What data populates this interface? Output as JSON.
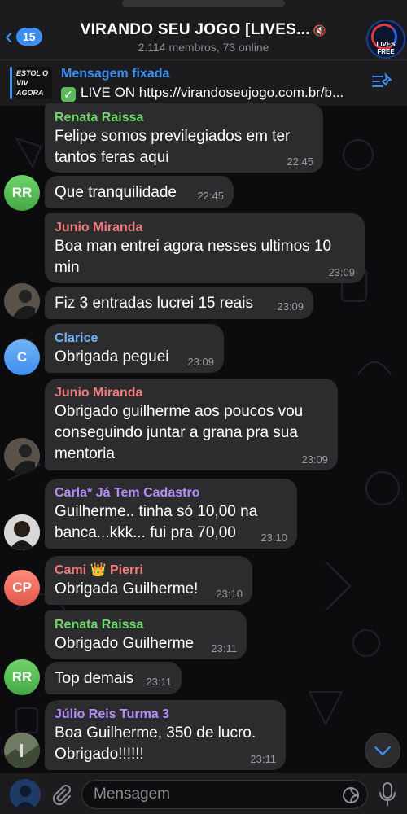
{
  "header": {
    "back_count": "15",
    "title": "VIRANDO SEU JOGO [LIVES...",
    "subtitle": "2.114 membros, 73 online",
    "group_avatar_text": "LIVES FREE"
  },
  "pinned": {
    "label": "Mensagem fixada",
    "text": "LIVE ON https://virandoseujogo.com.br/b...",
    "thumb_text": "ESTOL O VIV AGORA"
  },
  "messages": [
    {
      "sender": "Renata Raissa",
      "color": "#6fd66a",
      "lines": [
        "Felipe somos previlegiados em ter",
        "tantos feras aqui"
      ],
      "time": "22:45"
    },
    {
      "sender": "",
      "lines": [
        "Que tranquilidade"
      ],
      "time": "22:45",
      "avatar": "RR"
    },
    {
      "sender": "Junio Miranda",
      "color": "#f07a7a",
      "lines": [
        "Boa man entrei agora nesses ultimos 10",
        "min"
      ],
      "time": "23:09"
    },
    {
      "sender": "",
      "lines": [
        "Fiz 3 entradas lucrei 15 reais"
      ],
      "time": "23:09",
      "avatar": "photo"
    },
    {
      "sender": "Clarice",
      "color": "#6fb3ff",
      "lines": [
        "Obrigada peguei"
      ],
      "time": "23:09",
      "avatar": "C"
    },
    {
      "sender": "Junio Miranda",
      "color": "#f07a7a",
      "lines": [
        "Obrigado guilherme aos poucos vou",
        "conseguindo juntar a grana pra sua",
        "mentoria"
      ],
      "time": "23:09",
      "avatar": "photo"
    },
    {
      "sender": "Carla* Já Tem Cadastro",
      "color": "#b48cff",
      "lines": [
        "Guilherme.. tinha só 10,00 na",
        "banca...kkk... fui pra 70,00"
      ],
      "time": "23:10",
      "avatar": "photo"
    },
    {
      "sender": "Cami 👑 Pierri",
      "color": "#f07a7a",
      "lines": [
        "Obrigada Guilherme!"
      ],
      "time": "23:10",
      "avatar": "CP"
    },
    {
      "sender": "Renata Raissa",
      "color": "#6fd66a",
      "lines": [
        "Obrigado Guilherme"
      ],
      "time": "23:11"
    },
    {
      "sender": "",
      "lines": [
        "Top demais"
      ],
      "time": "23:11",
      "avatar": "RR"
    },
    {
      "sender": "Júlio Reis Turma 3",
      "color": "#b48cff",
      "lines": [
        "Boa Guilherme, 350 de lucro.",
        "Obrigado!!!!!!"
      ],
      "time": "23:11",
      "avatar": "photo"
    }
  ],
  "input": {
    "placeholder": "Mensagem"
  },
  "colors": {
    "accent": "#3d8ef0",
    "bubble": "#2c2c2e",
    "bar": "#1c1c1e"
  }
}
